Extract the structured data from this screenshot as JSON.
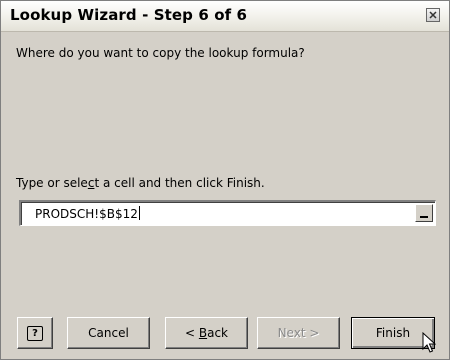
{
  "window": {
    "title": "Lookup Wizard - Step 6 of 6",
    "close_icon": "close-icon"
  },
  "main": {
    "question": "Where do you want to copy the lookup formula?",
    "prompt_before": "Type or sele",
    "prompt_mnemonic": "c",
    "prompt_after": "t a cell and then click Finish.",
    "cell_reference": {
      "value": "PRODSCH!$B$12"
    }
  },
  "buttons": {
    "help_label": "?",
    "cancel_label": "Cancel",
    "back_prefix": "< ",
    "back_mnemonic": "B",
    "back_rest": "ack",
    "next_label": "Next >",
    "finish_label": "Finish"
  },
  "colors": {
    "dialog_background": "#d4d0c8",
    "disabled_text": "#8a8a8a"
  }
}
